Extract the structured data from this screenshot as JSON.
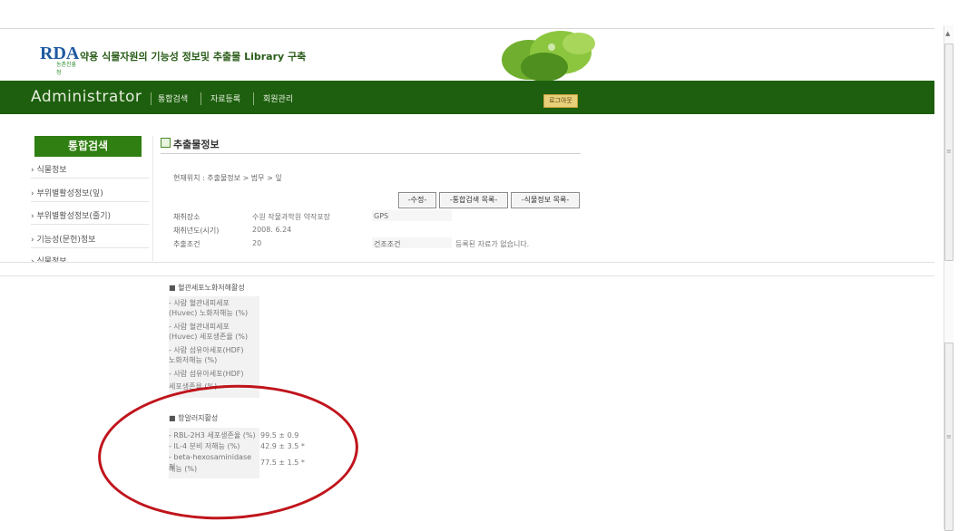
{
  "header": {
    "logo": {
      "mark": "RDA",
      "sub": "농촌진흥청"
    },
    "title": "약용 식물자원의 기능성 정보및 추출물 Library 구축"
  },
  "nav": {
    "admin": "Administrator",
    "items": [
      "통합검색",
      "자료등록",
      "회원관리"
    ],
    "logout": "로그아웃"
  },
  "sidebar": {
    "title": "통합검색",
    "items": [
      "› 식물정보",
      "› 부위별활성정보(잎)",
      "› 부위별활성정보(줄기)",
      "› 기능성(문헌)정보",
      "› 식물정보"
    ]
  },
  "main": {
    "title": "추출물정보",
    "breadcrumb": "현재위치 : 추출물정보 > 범무 > 잎",
    "buttons": [
      "-수정-",
      "-통합검색 목록-",
      "-식물정보 목록-"
    ],
    "info": {
      "collect_place_label": "채취장소",
      "collect_place_value": "수원 작물과학원 약작포장",
      "gps_label": "GPS",
      "collect_year_label": "채취년도(시기)",
      "collect_year_value": "2008. 6.24",
      "extract_label": "추출조건",
      "extract_value": "20",
      "dry_label": "건조조건",
      "dry_value": "등록된 자료가 없습니다."
    }
  },
  "lower": {
    "vascular": {
      "heading": "■ 혈관세포노화저해활성",
      "lines": [
        "- 사람 혈관내피세포",
        "(Huvec) 노화저해능 (%)",
        "- 사람 혈관내피세포",
        "(Huvec) 세포생존율 (%)",
        "- 사람 섬유아세포(HDF)",
        "노화저해능 (%)",
        "- 사람 섬유아세포(HDF)",
        "세포생존율 (%)"
      ]
    },
    "allergy": {
      "heading": "■ 항알러지활성",
      "rows": [
        {
          "label": "- RBL-2H3 세포생존율 (%)",
          "value": "99.5 ± 0.9"
        },
        {
          "label": "- IL-4 분비 저해능 (%)",
          "value": "42.9 ± 3.5 *"
        },
        {
          "label": "- beta-hexosaminidase 저",
          "label2": "해능 (%)",
          "value": "77.5 ± 1.5 *"
        }
      ]
    }
  },
  "colors": {
    "nav_green": "#1d5f0e",
    "side_title_green": "#2f7f12",
    "highlight_red": "#c0141c",
    "logout_gold": "#e8d07a"
  }
}
